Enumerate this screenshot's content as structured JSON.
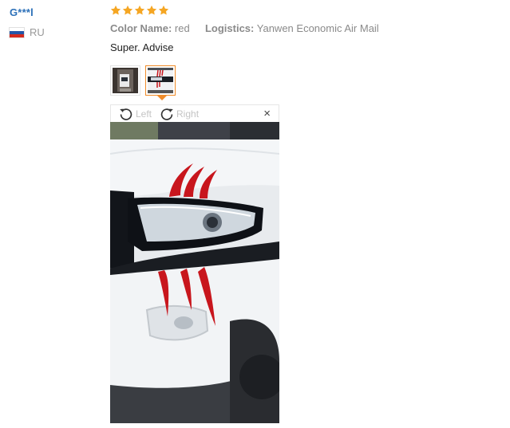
{
  "review": {
    "user_name": "G***l",
    "country_code": "RU",
    "rating": 5,
    "color_label": "Color Name:",
    "color_value": "red",
    "logistics_label": "Logistics:",
    "logistics_value": "Yanwen Economic Air Mail",
    "feedback_text": "Super. Advise"
  },
  "viewer": {
    "rotate_left_label": "Left",
    "rotate_right_label": "Right",
    "close_glyph": "×"
  },
  "colors": {
    "star": "#f5a623",
    "user_link": "#2a6fb8",
    "active_thumb_border": "#f08c2a",
    "claw_red": "#c8161d"
  },
  "icons": {
    "flag": "russia-flag-icon",
    "star": "star-icon",
    "rotate_left": "rotate-left-icon",
    "rotate_right": "rotate-right-icon",
    "close": "close-icon"
  }
}
